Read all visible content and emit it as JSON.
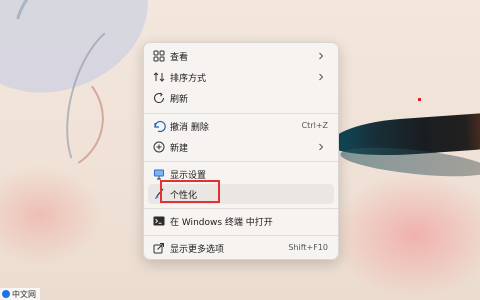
{
  "menu": {
    "items": [
      {
        "label": "查看",
        "icon": "grid-view-icon"
      },
      {
        "label": "排序方式",
        "icon": "sort-arrows-icon"
      },
      {
        "label": "刷新",
        "icon": "refresh-icon"
      },
      {
        "label": "撤消 删除",
        "shortcut": "Ctrl+Z",
        "icon": "undo-icon"
      },
      {
        "label": "新建",
        "icon": "new-plus-icon"
      },
      {
        "label": "显示设置",
        "icon": "display-settings-icon"
      },
      {
        "label": "个性化",
        "icon": "personalize-brush-icon"
      },
      {
        "label": "在 Windows 终端 中打开",
        "icon": "terminal-icon"
      },
      {
        "label": "显示更多选项",
        "shortcut": "Shift+F10",
        "icon": "more-options-icon"
      }
    ]
  },
  "watermark": {
    "text": "中文网"
  },
  "colors": {
    "accent": "#0067c0",
    "highlight_border": "#e53030",
    "menu_bg": "#f7f3f1"
  }
}
